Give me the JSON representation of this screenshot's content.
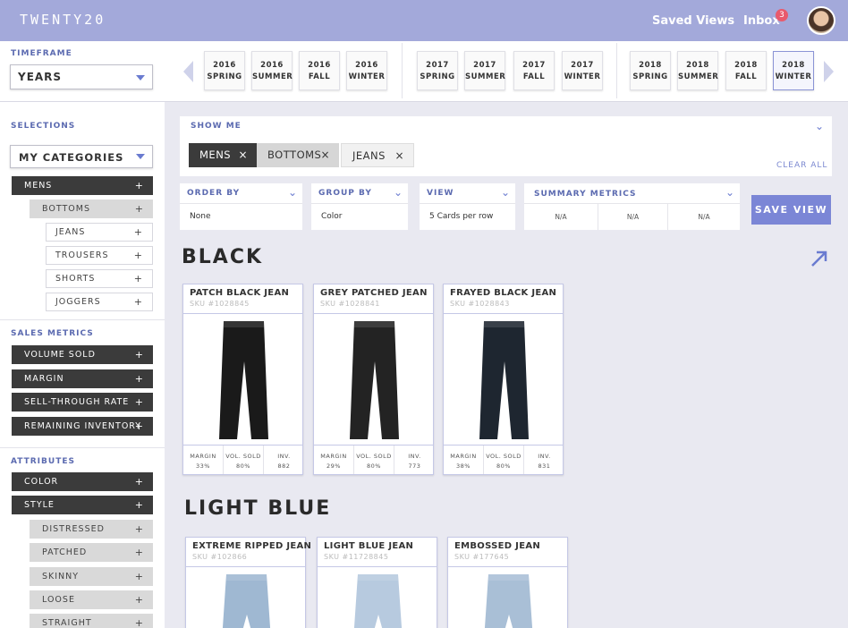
{
  "app": {
    "logo": "TWENTY20"
  },
  "header": {
    "saved_views": "Saved Views",
    "inbox": "Inbox",
    "inbox_count": "3"
  },
  "timeframe": {
    "label": "TIMEFRAME",
    "selected": "YEARS",
    "seasons": [
      {
        "year": "2016",
        "season": "SPRING"
      },
      {
        "year": "2016",
        "season": "SUMMER"
      },
      {
        "year": "2016",
        "season": "FALL"
      },
      {
        "year": "2016",
        "season": "WINTER"
      },
      {
        "year": "2017",
        "season": "SPRING"
      },
      {
        "year": "2017",
        "season": "SUMMER"
      },
      {
        "year": "2017",
        "season": "FALL"
      },
      {
        "year": "2017",
        "season": "WINTER"
      },
      {
        "year": "2018",
        "season": "SPRING"
      },
      {
        "year": "2018",
        "season": "SUMMER"
      },
      {
        "year": "2018",
        "season": "FALL"
      },
      {
        "year": "2018",
        "season": "WINTER"
      }
    ],
    "selected_season": "2018 WINTER"
  },
  "sidebar": {
    "selections_label": "SELECTIONS",
    "categories_select": "MY CATEGORIES",
    "tree": {
      "mens": "MENS",
      "bottoms": "BOTTOMS",
      "jeans": "JEANS",
      "trousers": "TROUSERS",
      "shorts": "SHORTS",
      "joggers": "JOGGERS"
    },
    "sales_metrics_label": "SALES METRICS",
    "sales_metrics": [
      "VOLUME SOLD",
      "MARGIN",
      "SELL-THROUGH RATE",
      "REMAINING INVENTORY"
    ],
    "attributes_label": "ATTRIBUTES",
    "attributes": {
      "color": "COLOR",
      "style": "STYLE",
      "styles": [
        "DISTRESSED",
        "PATCHED",
        "SKINNY",
        "LOOSE",
        "STRAIGHT"
      ]
    },
    "plus": "+"
  },
  "showme": {
    "label": "SHOW ME",
    "chips": [
      "MENS",
      "BOTTOMS",
      "JEANS"
    ],
    "clear_all": "CLEAR ALL",
    "remove": "×"
  },
  "controls": {
    "order_by": {
      "label": "ORDER BY",
      "value": "None"
    },
    "group_by": {
      "label": "GROUP BY",
      "value": "Color"
    },
    "view": {
      "label": "VIEW",
      "value": "5 Cards per row"
    },
    "summary_metrics": {
      "label": "SUMMARY METRICS",
      "values": [
        "N/A",
        "N/A",
        "N/A"
      ]
    },
    "save_view": "SAVE VIEW"
  },
  "groups": [
    {
      "title": "BLACK",
      "cards": [
        {
          "name": "PATCH BLACK JEAN",
          "sku": "SKU #1028845",
          "margin": "33%",
          "vol": "80%",
          "inv": "882",
          "fill": "#1a1a1a"
        },
        {
          "name": "GREY PATCHED JEAN",
          "sku": "SKU #1028841",
          "margin": "29%",
          "vol": "80%",
          "inv": "773",
          "fill": "#232323"
        },
        {
          "name": "FRAYED BLACK JEAN",
          "sku": "SKU #1028843",
          "margin": "38%",
          "vol": "80%",
          "inv": "831",
          "fill": "#1e2630"
        }
      ]
    },
    {
      "title": "LIGHT BLUE",
      "cards": [
        {
          "name": "EXTREME RIPPED JEAN",
          "sku": "SKU #102866",
          "fill": "#9fb8d2"
        },
        {
          "name": "LIGHT BLUE JEAN",
          "sku": "SKU #11728845",
          "fill": "#b7cadf"
        },
        {
          "name": "EMBOSSED JEAN",
          "sku": "SKU #177645",
          "fill": "#a9bfd6"
        }
      ]
    }
  ],
  "metric_labels": {
    "margin": "MARGIN",
    "vol": "VOL. SOLD",
    "inv": "INV."
  }
}
